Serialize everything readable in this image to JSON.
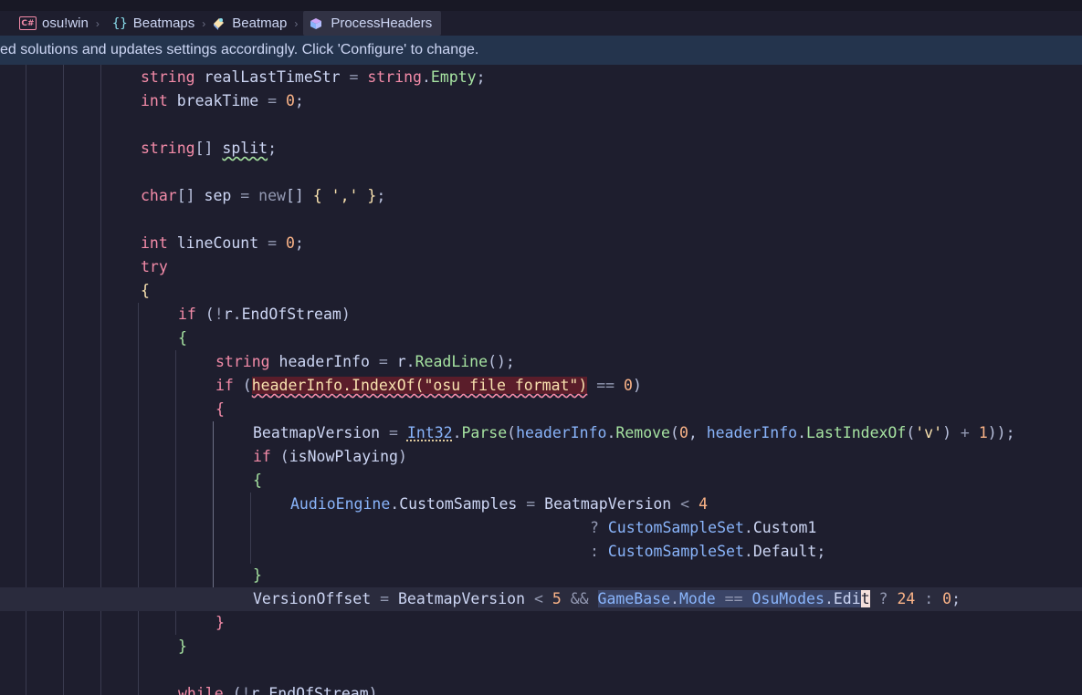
{
  "breadcrumb": {
    "project": "osu!win",
    "namespace": "Beatmaps",
    "class": "Beatmap",
    "method": "ProcessHeaders",
    "project_icon": "csharp-project-icon",
    "namespace_icon": "namespace-braces-icon",
    "class_icon": "class-icon",
    "method_icon": "method-icon"
  },
  "infobar": {
    "message": "ed solutions and updates settings accordingly. Click 'Configure' to change."
  },
  "code": {
    "tok": [
      "string",
      " realLastTimeStr ",
      "=",
      " string",
      ".",
      "Empty",
      ";",
      "int",
      " breakTime ",
      "=",
      " 0",
      ";",
      "string",
      "[]",
      " ",
      "split",
      ";",
      "char",
      "[]",
      " sep ",
      "=",
      " new",
      "[]",
      " {",
      " ','",
      " }",
      ";",
      "int",
      " lineCount ",
      "=",
      " 0",
      ";",
      "try",
      "{",
      "if",
      " (",
      "!",
      "r",
      ".",
      "EndOfStream",
      ")",
      "{",
      "string",
      " headerInfo ",
      "=",
      " r",
      ".",
      "ReadLine",
      "();",
      "if",
      " (",
      "headerInfo.IndexOf(\"osu file format\")",
      " ",
      "==",
      " 0",
      ")",
      "{",
      "BeatmapVersion",
      " = ",
      "Int32",
      ".",
      "Parse",
      "(",
      "headerInfo",
      ".",
      "Remove",
      "(",
      "0",
      ", ",
      "headerInfo",
      ".",
      "LastIndexOf",
      "(",
      "'v'",
      ")",
      " + ",
      "1",
      "));",
      "if",
      " (",
      "isNowPlaying",
      ")",
      "{",
      "AudioEngine",
      ".",
      "CustomSamples",
      " = ",
      "BeatmapVersion",
      " < ",
      "4",
      "? ",
      "CustomSampleSet",
      ".",
      "Custom1",
      ": ",
      "CustomSampleSet",
      ".",
      "Default",
      ";",
      "}",
      "VersionOffset",
      " = ",
      "BeatmapVersion",
      " < ",
      "5",
      " && ",
      "GameBase",
      ".",
      "Mode",
      " == ",
      "OsuModes",
      ".",
      "Edi",
      "t",
      " ? ",
      "24",
      " : ",
      "0",
      ";",
      "}",
      "}",
      "while",
      " (",
      "!",
      "r",
      ".",
      "EndOfStream",
      ")"
    ]
  }
}
